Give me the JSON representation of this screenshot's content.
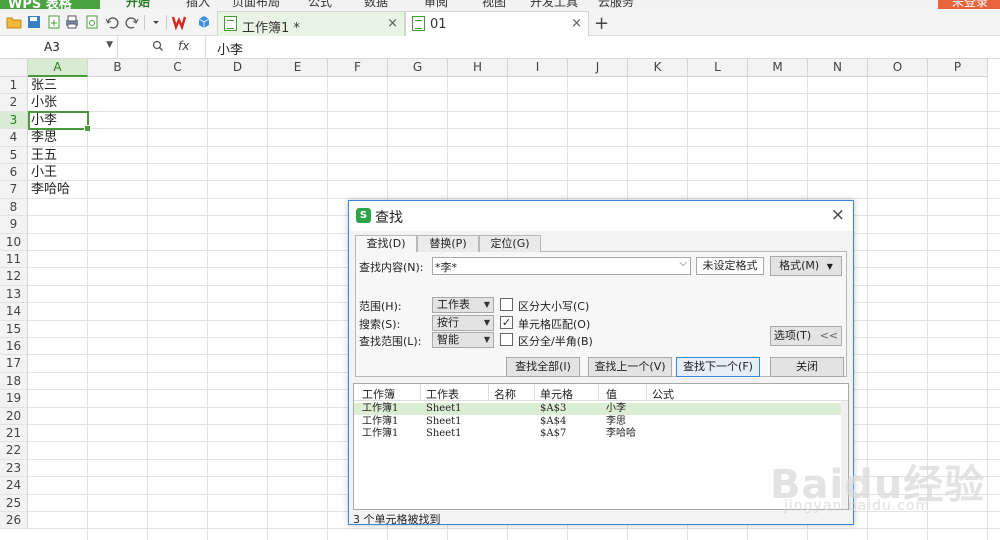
{
  "ribbon": {
    "brand": "WPS 表格",
    "tabs": [
      "开始",
      "插入",
      "页面布局",
      "公式",
      "数据",
      "审阅",
      "视图",
      "开发工具",
      "云服务"
    ],
    "login": "未登录"
  },
  "doc_tabs": [
    {
      "label": "工作簿1 *",
      "close": "×"
    },
    {
      "label": "01",
      "close": "×"
    }
  ],
  "new_tab": "+",
  "formula_bar": {
    "name_box": "A3",
    "zoom_icon": "magnifier-icon",
    "fx": "fx",
    "content": "小李"
  },
  "columns": [
    "A",
    "B",
    "C",
    "D",
    "E",
    "F",
    "G",
    "H",
    "I",
    "J",
    "K",
    "L",
    "M",
    "N",
    "O",
    "P"
  ],
  "rows": [
    "1",
    "2",
    "3",
    "4",
    "5",
    "6",
    "7",
    "8",
    "9",
    "10",
    "11",
    "12",
    "13",
    "14",
    "15",
    "16",
    "17",
    "18",
    "19",
    "20",
    "21",
    "22",
    "23",
    "24",
    "25",
    "26"
  ],
  "selected_cell": "A3",
  "cells": [
    "张三",
    "小张",
    "小李",
    "李思",
    "王五",
    "小王",
    "李哈哈"
  ],
  "dialog": {
    "title": "查找",
    "tabs": [
      "查找(D)",
      "替换(P)",
      "定位(G)"
    ],
    "find_label": "查找内容(N):",
    "find_value": "*李*",
    "no_format": "未设定格式",
    "format_btn": "格式(M)",
    "scope_label": "范围(H):",
    "scope_value": "工作表",
    "search_label": "搜索(S):",
    "search_value": "按行",
    "range_label": "查找范围(L):",
    "range_value": "智能",
    "match_case": {
      "label": "区分大小写(C)",
      "checked": false,
      "mark": ""
    },
    "match_cell": {
      "label": "单元格匹配(O)",
      "checked": true,
      "mark": "✓"
    },
    "match_width": {
      "label": "区分全/半角(B)",
      "checked": false,
      "mark": ""
    },
    "options_btn": "选项(T)",
    "options_chevron": "<<",
    "find_all": "查找全部(I)",
    "find_prev": "查找上一个(V)",
    "find_next": "查找下一个(F)",
    "close_btn": "关闭",
    "close_icon": "×",
    "result_headers": [
      "工作簿",
      "工作表",
      "名称",
      "单元格",
      "值",
      "公式"
    ],
    "results": [
      {
        "book": "工作簿1",
        "sheet": "Sheet1",
        "name": "",
        "cell": "$A$3",
        "value": "小李",
        "formula": ""
      },
      {
        "book": "工作簿1",
        "sheet": "Sheet1",
        "name": "",
        "cell": "$A$4",
        "value": "李思",
        "formula": ""
      },
      {
        "book": "工作簿1",
        "sheet": "Sheet1",
        "name": "",
        "cell": "$A$7",
        "value": "李哈哈",
        "formula": ""
      }
    ],
    "status": "3 个单元格被找到"
  },
  "watermark": {
    "brand": "Baidu经验",
    "sub": "jingyan.baidu.com"
  },
  "colors": {
    "accent": "#4aa33f",
    "login": "#e8633b",
    "dialog_border": "#3a88d8",
    "result_highlight": "#dbeed3"
  }
}
